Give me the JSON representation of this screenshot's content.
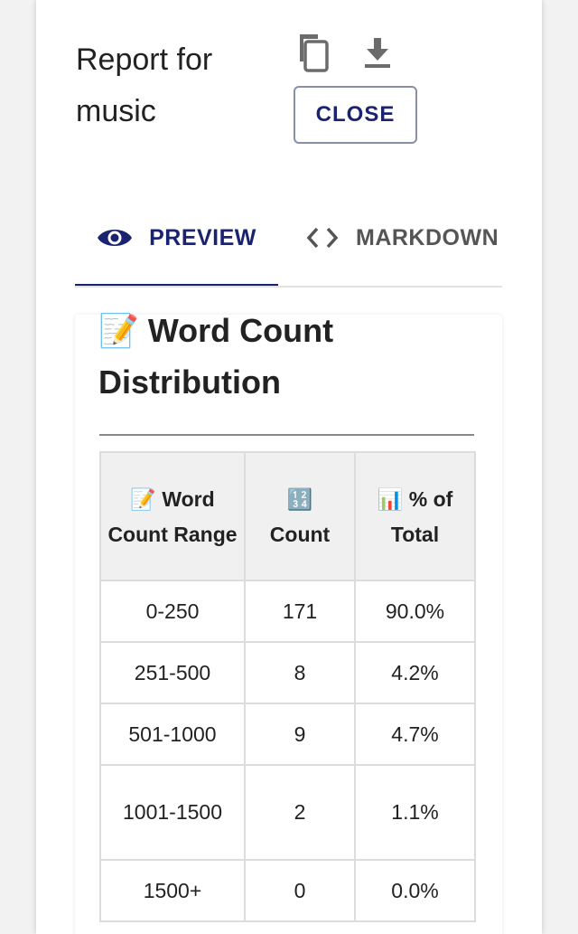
{
  "dialog": {
    "title": "Report for music",
    "close_label": "CLOSE",
    "copy_icon": "copy-icon",
    "download_icon": "download-icon"
  },
  "tabs": [
    {
      "label": "PREVIEW",
      "icon": "eye-icon",
      "selected": true
    },
    {
      "label": "MARKDOWN SOURCE",
      "icon": "code-icon",
      "selected": false
    }
  ],
  "section": {
    "emoji": "📝",
    "title": "Word Count Distribution"
  },
  "table": {
    "headers": [
      {
        "emoji": "📝",
        "label": "Word Count Range"
      },
      {
        "emoji": "🔢",
        "label": "Count"
      },
      {
        "emoji": "📊",
        "label": "% of Total"
      }
    ],
    "rows": [
      {
        "range": "0-250",
        "count": "171",
        "percent": "90.0%"
      },
      {
        "range": "251-500",
        "count": "8",
        "percent": "4.2%"
      },
      {
        "range": "501-1000",
        "count": "9",
        "percent": "4.7%"
      },
      {
        "range": "1001-1500",
        "count": "2",
        "percent": "1.1%"
      },
      {
        "range": "1500+",
        "count": "0",
        "percent": "0.0%"
      }
    ]
  },
  "colors": {
    "accent": "#1a2370",
    "tab_inactive": "#555555",
    "header_bg": "#f0f0f0",
    "border": "#dcdcdc"
  }
}
